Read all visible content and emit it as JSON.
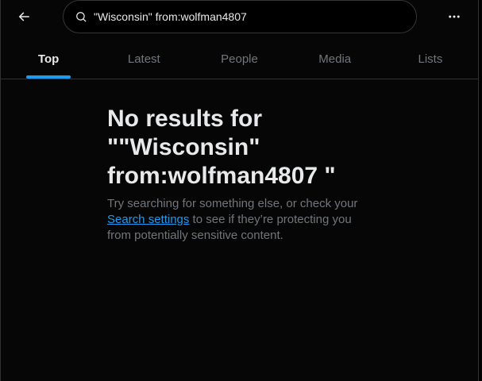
{
  "search": {
    "query": "\"Wisconsin\" from:wolfman4807"
  },
  "tabs": [
    {
      "label": "Top",
      "active": true
    },
    {
      "label": "Latest",
      "active": false
    },
    {
      "label": "People",
      "active": false
    },
    {
      "label": "Media",
      "active": false
    },
    {
      "label": "Lists",
      "active": false
    }
  ],
  "empty_state": {
    "title": "No results for \"\"Wisconsin\" from:wolfman4807 \"",
    "body_before": "Try searching for something else, or check your ",
    "link": "Search settings",
    "body_after": " to see if they’re protecting you from potentially sensitive content."
  },
  "icons": {
    "back": "arrow-left-icon",
    "search": "search-icon",
    "more": "more-horizontal-icon"
  },
  "colors": {
    "accent": "#1d9bf0",
    "text_primary": "#e7e9ea",
    "text_secondary": "#71767b",
    "border": "#2f3336"
  }
}
